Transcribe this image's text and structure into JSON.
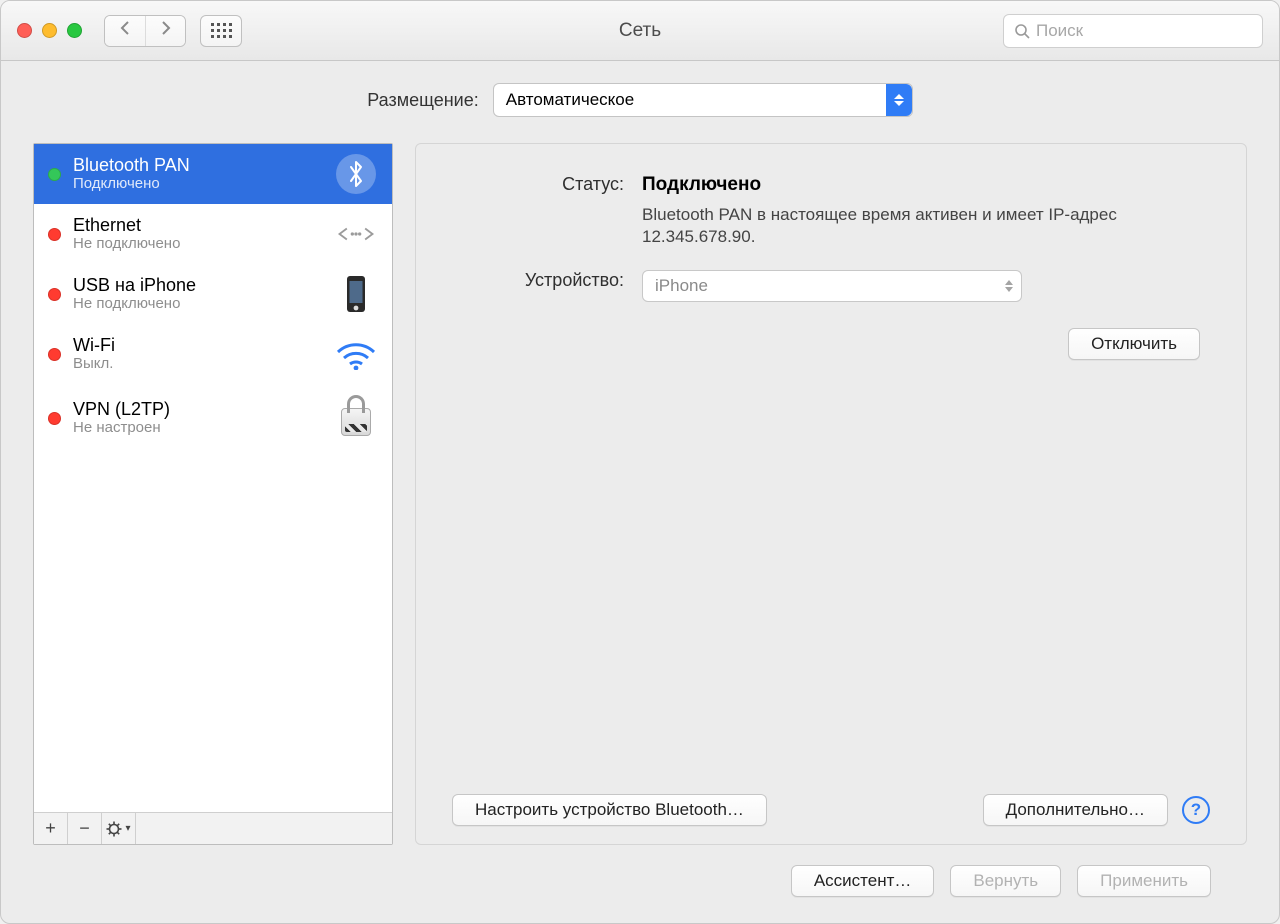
{
  "window": {
    "title": "Сеть",
    "search_placeholder": "Поиск"
  },
  "location": {
    "label": "Размещение:",
    "value": "Автоматическое"
  },
  "sidebar": {
    "items": [
      {
        "title": "Bluetooth PAN",
        "subtitle": "Подключено",
        "status": "green",
        "icon": "bluetooth-icon",
        "selected": true
      },
      {
        "title": "Ethernet",
        "subtitle": "Не подключено",
        "status": "red",
        "icon": "ethernet-icon",
        "selected": false
      },
      {
        "title": "USB на iPhone",
        "subtitle": "Не подключено",
        "status": "red",
        "icon": "iphone-icon",
        "selected": false
      },
      {
        "title": "Wi-Fi",
        "subtitle": "Выкл.",
        "status": "red",
        "icon": "wifi-icon",
        "selected": false
      },
      {
        "title": "VPN (L2TP)",
        "subtitle": "Не настроен",
        "status": "red",
        "icon": "lock-icon",
        "selected": false
      }
    ]
  },
  "detail": {
    "status_label": "Статус:",
    "status_value": "Подключено",
    "status_desc": "Bluetooth PAN в настоящее время активен и имеет IP-адрес 12.345.678.90.",
    "device_label": "Устройство:",
    "device_value": "iPhone",
    "disconnect": "Отключить",
    "configure_bluetooth": "Настроить устройство Bluetooth…",
    "advanced": "Дополнительно…"
  },
  "footer": {
    "assistant": "Ассистент…",
    "revert": "Вернуть",
    "apply": "Применить"
  }
}
